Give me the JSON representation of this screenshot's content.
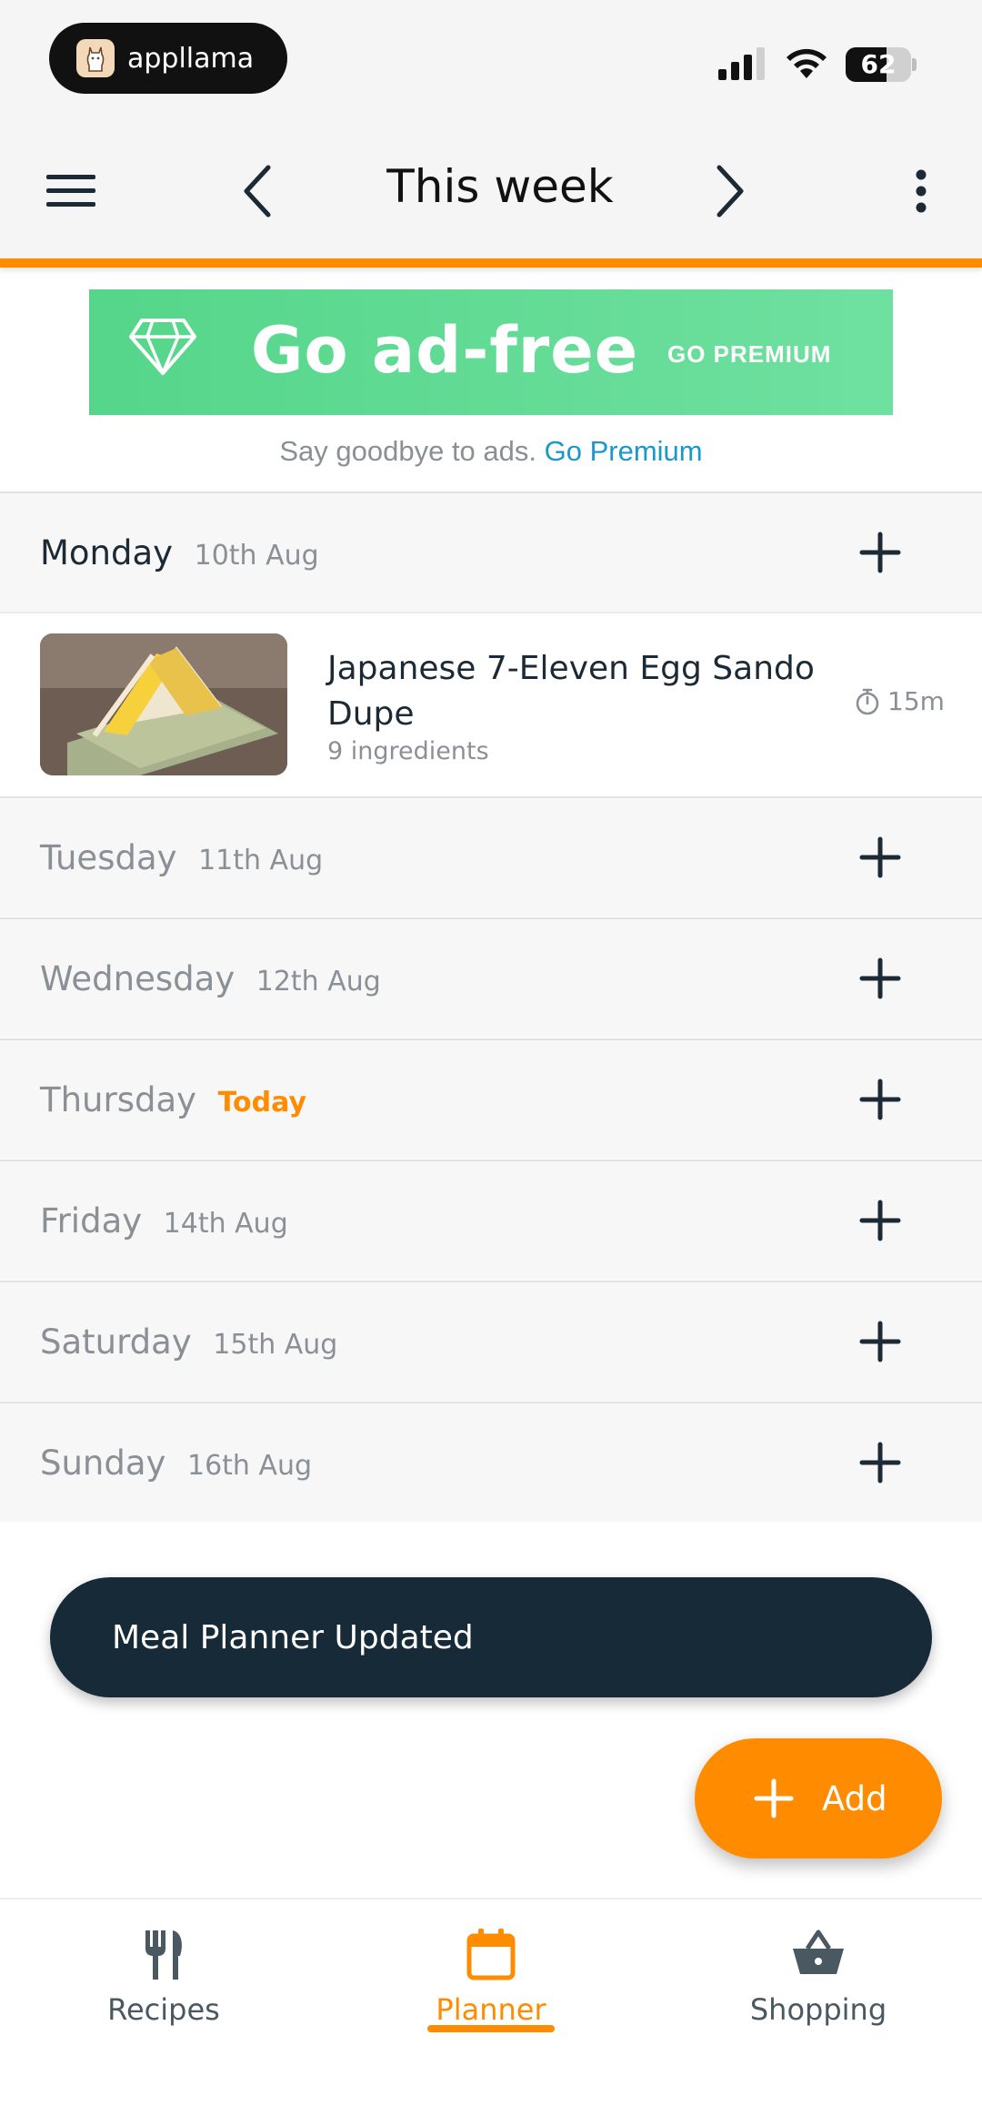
{
  "status_bar": {
    "app_pill_name": "appllama",
    "battery_percent": 62,
    "battery_label": "62"
  },
  "topbar": {
    "title": "This week",
    "menu_icon": "hamburger-icon",
    "prev_icon": "chevron-left-icon",
    "next_icon": "chevron-right-icon",
    "more_icon": "more-vertical-icon"
  },
  "ad": {
    "headline": "Go ad-free",
    "cta": "GO PREMIUM",
    "subtext": "Say goodbye to ads.",
    "link": "Go Premium",
    "colors": {
      "banner": "#55d68a",
      "link": "#1a98c9"
    }
  },
  "days": [
    {
      "day": "Monday",
      "date": "10th Aug",
      "today": false
    },
    {
      "day": "Tuesday",
      "date": "11th Aug",
      "today": false
    },
    {
      "day": "Wednesday",
      "date": "12th Aug",
      "today": false
    },
    {
      "day": "Thursday",
      "date": "Today",
      "today": true
    },
    {
      "day": "Friday",
      "date": "14th Aug",
      "today": false
    },
    {
      "day": "Saturday",
      "date": "15th Aug",
      "today": false
    },
    {
      "day": "Sunday",
      "date": "16th Aug",
      "today": false
    }
  ],
  "meal": {
    "title": "Japanese 7-Eleven Egg Sando Dupe",
    "ingredients": "9 ingredients",
    "time": "15m"
  },
  "snackbar": {
    "message": "Meal Planner Updated"
  },
  "fab": {
    "label": "Add"
  },
  "bottom_nav": {
    "items": [
      {
        "label": "Recipes",
        "icon": "fork-knife-icon",
        "active": false
      },
      {
        "label": "Planner",
        "icon": "calendar-icon",
        "active": true
      },
      {
        "label": "Shopping",
        "icon": "basket-icon",
        "active": false
      }
    ]
  },
  "colors": {
    "accent": "#ff8c00",
    "dark": "#172a38"
  }
}
